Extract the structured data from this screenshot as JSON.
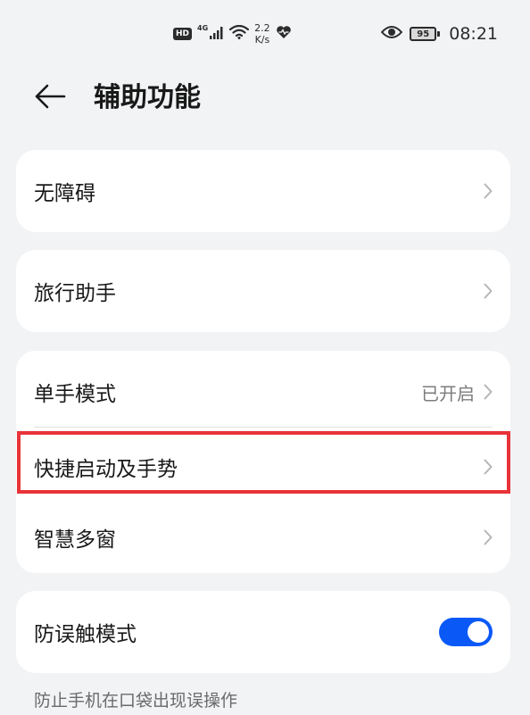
{
  "status_bar": {
    "hd_label": "HD",
    "network_type": "4G",
    "speed_value": "2.2",
    "speed_unit": "K/s",
    "battery_level": "95",
    "time": "08:21"
  },
  "header": {
    "title": "辅助功能"
  },
  "sections": {
    "accessibility": {
      "label": "无障碍"
    },
    "travel_assistant": {
      "label": "旅行助手"
    },
    "one_hand_mode": {
      "label": "单手模式",
      "value": "已开启"
    },
    "shortcuts_gestures": {
      "label": "快捷启动及手势"
    },
    "smart_multiwindow": {
      "label": "智慧多窗"
    },
    "mistouch_mode": {
      "label": "防误触模式",
      "enabled": true
    }
  },
  "footnote": "防止手机在口袋出现误操作",
  "colors": {
    "accent": "#0a59f7",
    "highlight": "#e83338",
    "background": "#f1f3f5"
  }
}
